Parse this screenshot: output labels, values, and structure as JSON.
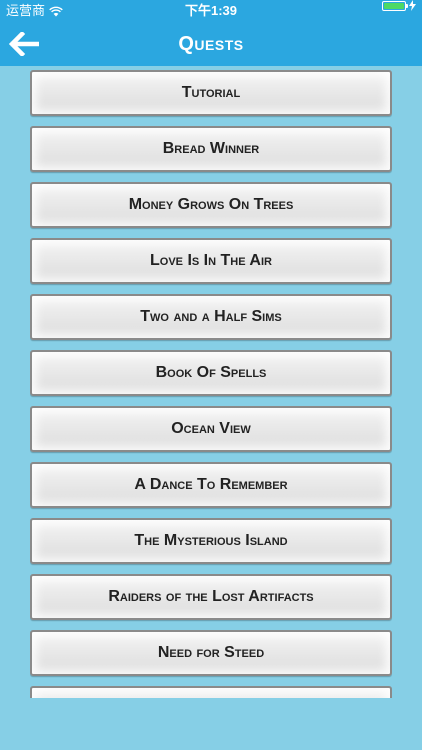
{
  "status": {
    "carrier": "运营商",
    "time": "下午1:39"
  },
  "header": {
    "title": "Quests",
    "back_icon": "arrow-left-icon"
  },
  "quests": [
    "Tutorial",
    "Bread Winner",
    "Money Grows On Trees",
    "Love Is In The Air",
    "Two and a Half Sims",
    "Book Of Spells",
    "Ocean View",
    "A Dance To Remember",
    "The Mysterious Island",
    "Raiders of the Lost Artifacts",
    "Need for Steed",
    ""
  ]
}
